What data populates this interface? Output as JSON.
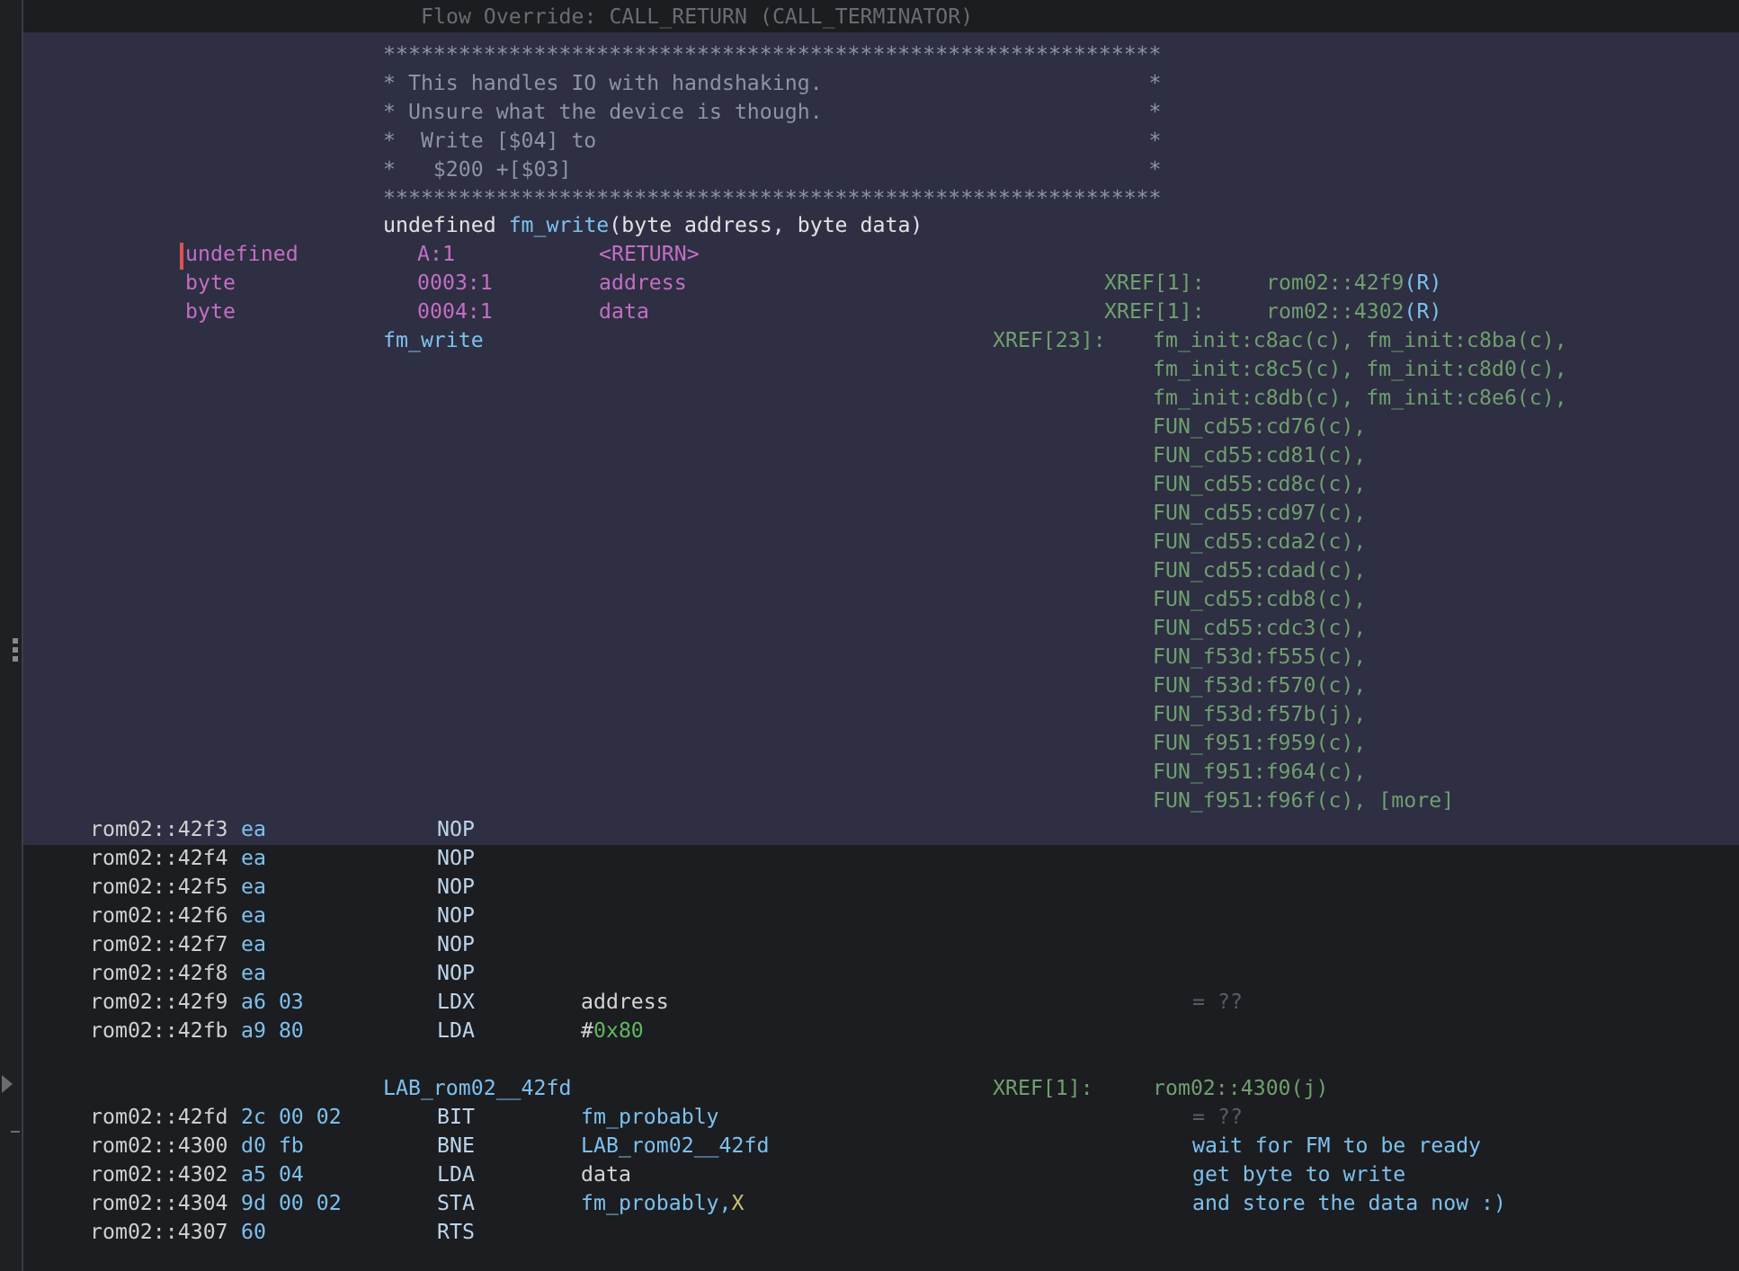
{
  "top_line": "Flow Override: CALL_RETURN (CALL_TERMINATOR)",
  "function_header": {
    "selected": true,
    "comment_lines": [
      "**************************************************************",
      "* This handles IO with handshaking.                          *",
      "* Unsure what the device is though.                          *",
      "*  Write [$04] to                                            *",
      "*   $200 +[$03]                                              *",
      "**************************************************************"
    ],
    "signature": {
      "return_type": "undefined",
      "name": "fm_write",
      "params": "(byte address, byte data)"
    },
    "variables": [
      {
        "type": "undefined",
        "storage": "A:1",
        "name": "<RETURN>"
      },
      {
        "type": "byte",
        "storage": "0003:1",
        "name": "address",
        "xref_label": "XREF[1]:",
        "xref": "rom02::42f9",
        "xref_suffix": "(R)"
      },
      {
        "type": "byte",
        "storage": "0004:1",
        "name": "data",
        "xref_label": "XREF[1]:",
        "xref": "rom02::4302",
        "xref_suffix": "(R)"
      }
    ],
    "label": "fm_write",
    "xref_label": "XREF[23]:",
    "xrefs": [
      "fm_init:c8ac(c), fm_init:c8ba(c),",
      "fm_init:c8c5(c), fm_init:c8d0(c),",
      "fm_init:c8db(c), fm_init:c8e6(c),",
      "FUN_cd55:cd76(c),",
      "FUN_cd55:cd81(c),",
      "FUN_cd55:cd8c(c),",
      "FUN_cd55:cd97(c),",
      "FUN_cd55:cda2(c),",
      "FUN_cd55:cdad(c),",
      "FUN_cd55:cdb8(c),",
      "FUN_cd55:cdc3(c),",
      "FUN_f53d:f555(c),",
      "FUN_f53d:f570(c),",
      "FUN_f53d:f57b(j),",
      "FUN_f951:f959(c),",
      "FUN_f951:f964(c),",
      "FUN_f951:f96f(c),"
    ],
    "more": "[more]"
  },
  "listing": [
    {
      "kind": "instruction",
      "selected": true,
      "address": "rom02::42f3",
      "bytes": "ea",
      "mnemonic": "NOP"
    },
    {
      "kind": "instruction",
      "selected": false,
      "address": "rom02::42f4",
      "bytes": "ea",
      "mnemonic": "NOP"
    },
    {
      "kind": "instruction",
      "selected": false,
      "address": "rom02::42f5",
      "bytes": "ea",
      "mnemonic": "NOP"
    },
    {
      "kind": "instruction",
      "selected": false,
      "address": "rom02::42f6",
      "bytes": "ea",
      "mnemonic": "NOP"
    },
    {
      "kind": "instruction",
      "selected": false,
      "address": "rom02::42f7",
      "bytes": "ea",
      "mnemonic": "NOP"
    },
    {
      "kind": "instruction",
      "selected": false,
      "address": "rom02::42f8",
      "bytes": "ea",
      "mnemonic": "NOP"
    },
    {
      "kind": "instruction",
      "selected": false,
      "address": "rom02::42f9",
      "bytes": "a6 03",
      "mnemonic": "LDX",
      "operand": [
        {
          "kind": "variable",
          "text": "address"
        }
      ],
      "comment": {
        "kind": "value",
        "text": "= ??"
      }
    },
    {
      "kind": "instruction",
      "selected": false,
      "address": "rom02::42fb",
      "bytes": "a9 80",
      "mnemonic": "LDA",
      "operand": [
        {
          "kind": "plain",
          "text": "#"
        },
        {
          "kind": "scalar",
          "text": "0x80"
        }
      ]
    },
    {
      "kind": "blank"
    },
    {
      "kind": "label",
      "label": "LAB_rom02__42fd",
      "xref_label": "XREF[1]:",
      "xref": "rom02::4300(j)"
    },
    {
      "kind": "instruction",
      "selected": false,
      "address": "rom02::42fd",
      "bytes": "2c 00 02",
      "mnemonic": "BIT",
      "operand": [
        {
          "kind": "symbol",
          "text": "fm_probably"
        }
      ],
      "comment": {
        "kind": "value",
        "text": "= ??"
      }
    },
    {
      "kind": "instruction",
      "selected": false,
      "address": "rom02::4300",
      "bytes": "d0 fb",
      "mnemonic": "BNE",
      "operand": [
        {
          "kind": "symbol",
          "text": "LAB_rom02__42fd"
        }
      ],
      "comment": {
        "kind": "user",
        "text": "wait for FM to be ready"
      }
    },
    {
      "kind": "instruction",
      "selected": false,
      "address": "rom02::4302",
      "bytes": "a5 04",
      "mnemonic": "LDA",
      "operand": [
        {
          "kind": "variable",
          "text": "data"
        }
      ],
      "comment": {
        "kind": "user",
        "text": "get byte to write"
      }
    },
    {
      "kind": "instruction",
      "selected": false,
      "address": "rom02::4304",
      "bytes": "9d 00 02",
      "mnemonic": "STA",
      "operand": [
        {
          "kind": "symbol",
          "text": "fm_probably,"
        },
        {
          "kind": "register",
          "text": "X"
        }
      ],
      "comment": {
        "kind": "user",
        "text": "and store the data now :)"
      }
    },
    {
      "kind": "instruction",
      "selected": false,
      "address": "rom02::4307",
      "bytes": "60",
      "mnemonic": "RTS"
    }
  ]
}
